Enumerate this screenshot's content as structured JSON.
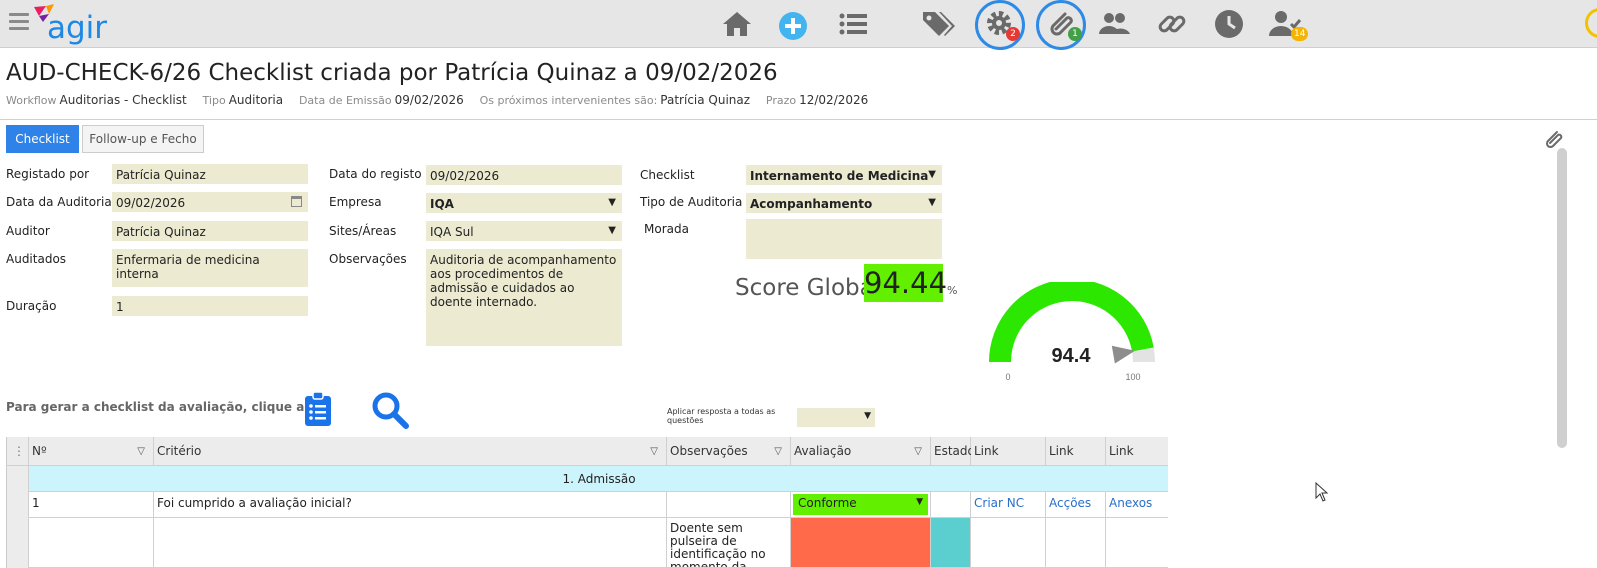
{
  "app": {
    "logo_text": "agir"
  },
  "topbar": {
    "icons": [
      {
        "name": "home-icon"
      },
      {
        "name": "add-icon"
      },
      {
        "name": "list-icon"
      },
      {
        "name": "tags-icon"
      },
      {
        "name": "gear-icon",
        "badge": "2",
        "badge_color": "#e53935"
      },
      {
        "name": "paperclip-icon",
        "badge": "1",
        "badge_color": "#43a047"
      },
      {
        "name": "users-icon"
      },
      {
        "name": "link-icon"
      },
      {
        "name": "clock-icon"
      },
      {
        "name": "user-check-icon",
        "badge": "14",
        "badge_color": "#f5b400"
      }
    ]
  },
  "header": {
    "title": "AUD-CHECK-6/26 Checklist criada por Patrícia Quinaz a 09/02/2026",
    "meta": [
      {
        "label": "Workflow",
        "value": "Auditorias - Checklist"
      },
      {
        "label": "Tipo",
        "value": "Auditoria"
      },
      {
        "label": "Data de Emissão",
        "value": "09/02/2026"
      },
      {
        "label": "Os próximos intervenientes são:",
        "value": "Patrícia Quinaz"
      },
      {
        "label": "Prazo",
        "value": "12/02/2026"
      }
    ]
  },
  "tabs": {
    "checklist": "Checklist",
    "followup": "Follow-up e Fecho"
  },
  "form": {
    "registado_por_label": "Registado por",
    "registado_por": "Patrícia Quinaz",
    "data_auditoria_label": "Data da Auditoria",
    "data_auditoria": "09/02/2026",
    "auditor_label": "Auditor",
    "auditor": "Patrícia Quinaz",
    "auditados_label": "Auditados",
    "auditados": "Enfermaria de medicina interna",
    "duracao_label": "Duração",
    "duracao": "1",
    "data_registo_label": "Data do registo",
    "data_registo": "09/02/2026",
    "empresa_label": "Empresa",
    "empresa": "IQA",
    "sites_label": "Sites/Áreas",
    "sites": "IQA Sul",
    "observacoes_label": "Observações",
    "observacoes": "Auditoria de acompanhamento aos procedimentos de admissão e cuidados ao doente internado.",
    "checklist_label": "Checklist",
    "checklist": "Internamento de Medicina",
    "tipo_auditoria_label": "Tipo de Auditoria",
    "tipo_auditoria": "Acompanhamento",
    "morada_label": "Morada",
    "morada": ""
  },
  "score": {
    "label": "Score Global",
    "value": "94.44",
    "unit": "%",
    "gauge_value": 94.4,
    "gauge_min": "0",
    "gauge_max": "100",
    "gauge_display": "94.4",
    "color": "#2ce800"
  },
  "actions": {
    "gen_label": "Para gerar a checklist da avaliação, clique aqui:",
    "apply_label": "Aplicar resposta a todas as questões",
    "apply_value": ""
  },
  "grid": {
    "headers": [
      "Nº",
      "Critério",
      "Observações",
      "Avaliação",
      "Estado",
      "Link",
      "Link",
      "Link"
    ],
    "group": "1. Admissão",
    "rows": [
      {
        "no": "1",
        "criterio": "Foi cumprido a avaliação inicial?",
        "obs": "",
        "avaliacao": "Conforme",
        "estado": "",
        "l1": "Criar NC",
        "l2": "Acções",
        "l3": "Anexos"
      },
      {
        "no": "",
        "criterio": "",
        "obs": "Doente sem pulseira de identificação no momento da",
        "avaliacao": "",
        "estado": "",
        "l1": "",
        "l2": "",
        "l3": ""
      }
    ]
  }
}
